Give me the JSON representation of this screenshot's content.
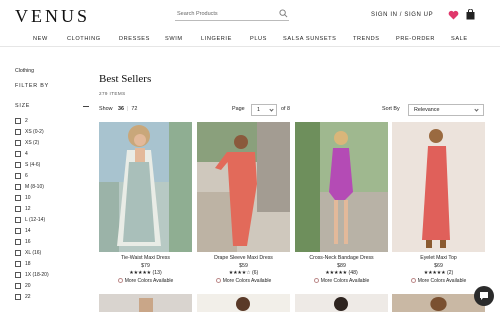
{
  "header": {
    "logo": "VENUS",
    "search_placeholder": "Search Products",
    "signin": "SIGN IN / SIGN UP"
  },
  "nav": [
    "NEW",
    "CLOTHING",
    "DRESSES",
    "SWIM",
    "LINGERIE",
    "PLUS",
    "SALSA SUNSETS",
    "TRENDS",
    "PRE-ORDER",
    "SALE"
  ],
  "sidebar": {
    "breadcrumb": "Clothing",
    "filter_by": "FILTER BY",
    "size_heading": "SIZE",
    "sizes": [
      "2",
      "XS (0-2)",
      "XS (2)",
      "4",
      "S (4-6)",
      "6",
      "M (8-10)",
      "10",
      "12",
      "L (12-14)",
      "14",
      "16",
      "XL (16)",
      "18",
      "1X (18-20)",
      "20",
      "22"
    ]
  },
  "main": {
    "title": "Best Sellers",
    "item_count": "279 ITEMS",
    "show_label": "Show",
    "show_active": "36",
    "show_alt": "72",
    "page_label": "Page",
    "page_value": "1",
    "page_of": "of 8",
    "sort_label": "Sort By",
    "sort_value": "Relevance"
  },
  "products": [
    {
      "name": "Tie-Waist Maxi Dress",
      "price": "$79",
      "stars": "★★★★★",
      "reviews": "(13)",
      "colors": "More Colors Available"
    },
    {
      "name": "Drape Sleeve Maxi Dress",
      "price": "$59",
      "stars": "★★★★☆",
      "reviews": "(6)",
      "colors": "More Colors Available"
    },
    {
      "name": "Cross-Neck Bandage Dress",
      "price": "$89",
      "stars": "★★★★★",
      "reviews": "(48)",
      "colors": "More Colors Available"
    },
    {
      "name": "Eyelet Maxi Top",
      "price": "$69",
      "stars": "★★★★★",
      "reviews": "(2)",
      "colors": "More Colors Available"
    }
  ],
  "colors": {
    "accent": "#d81b60",
    "heart": "#e0386b",
    "chat": "#2b2b2b"
  }
}
